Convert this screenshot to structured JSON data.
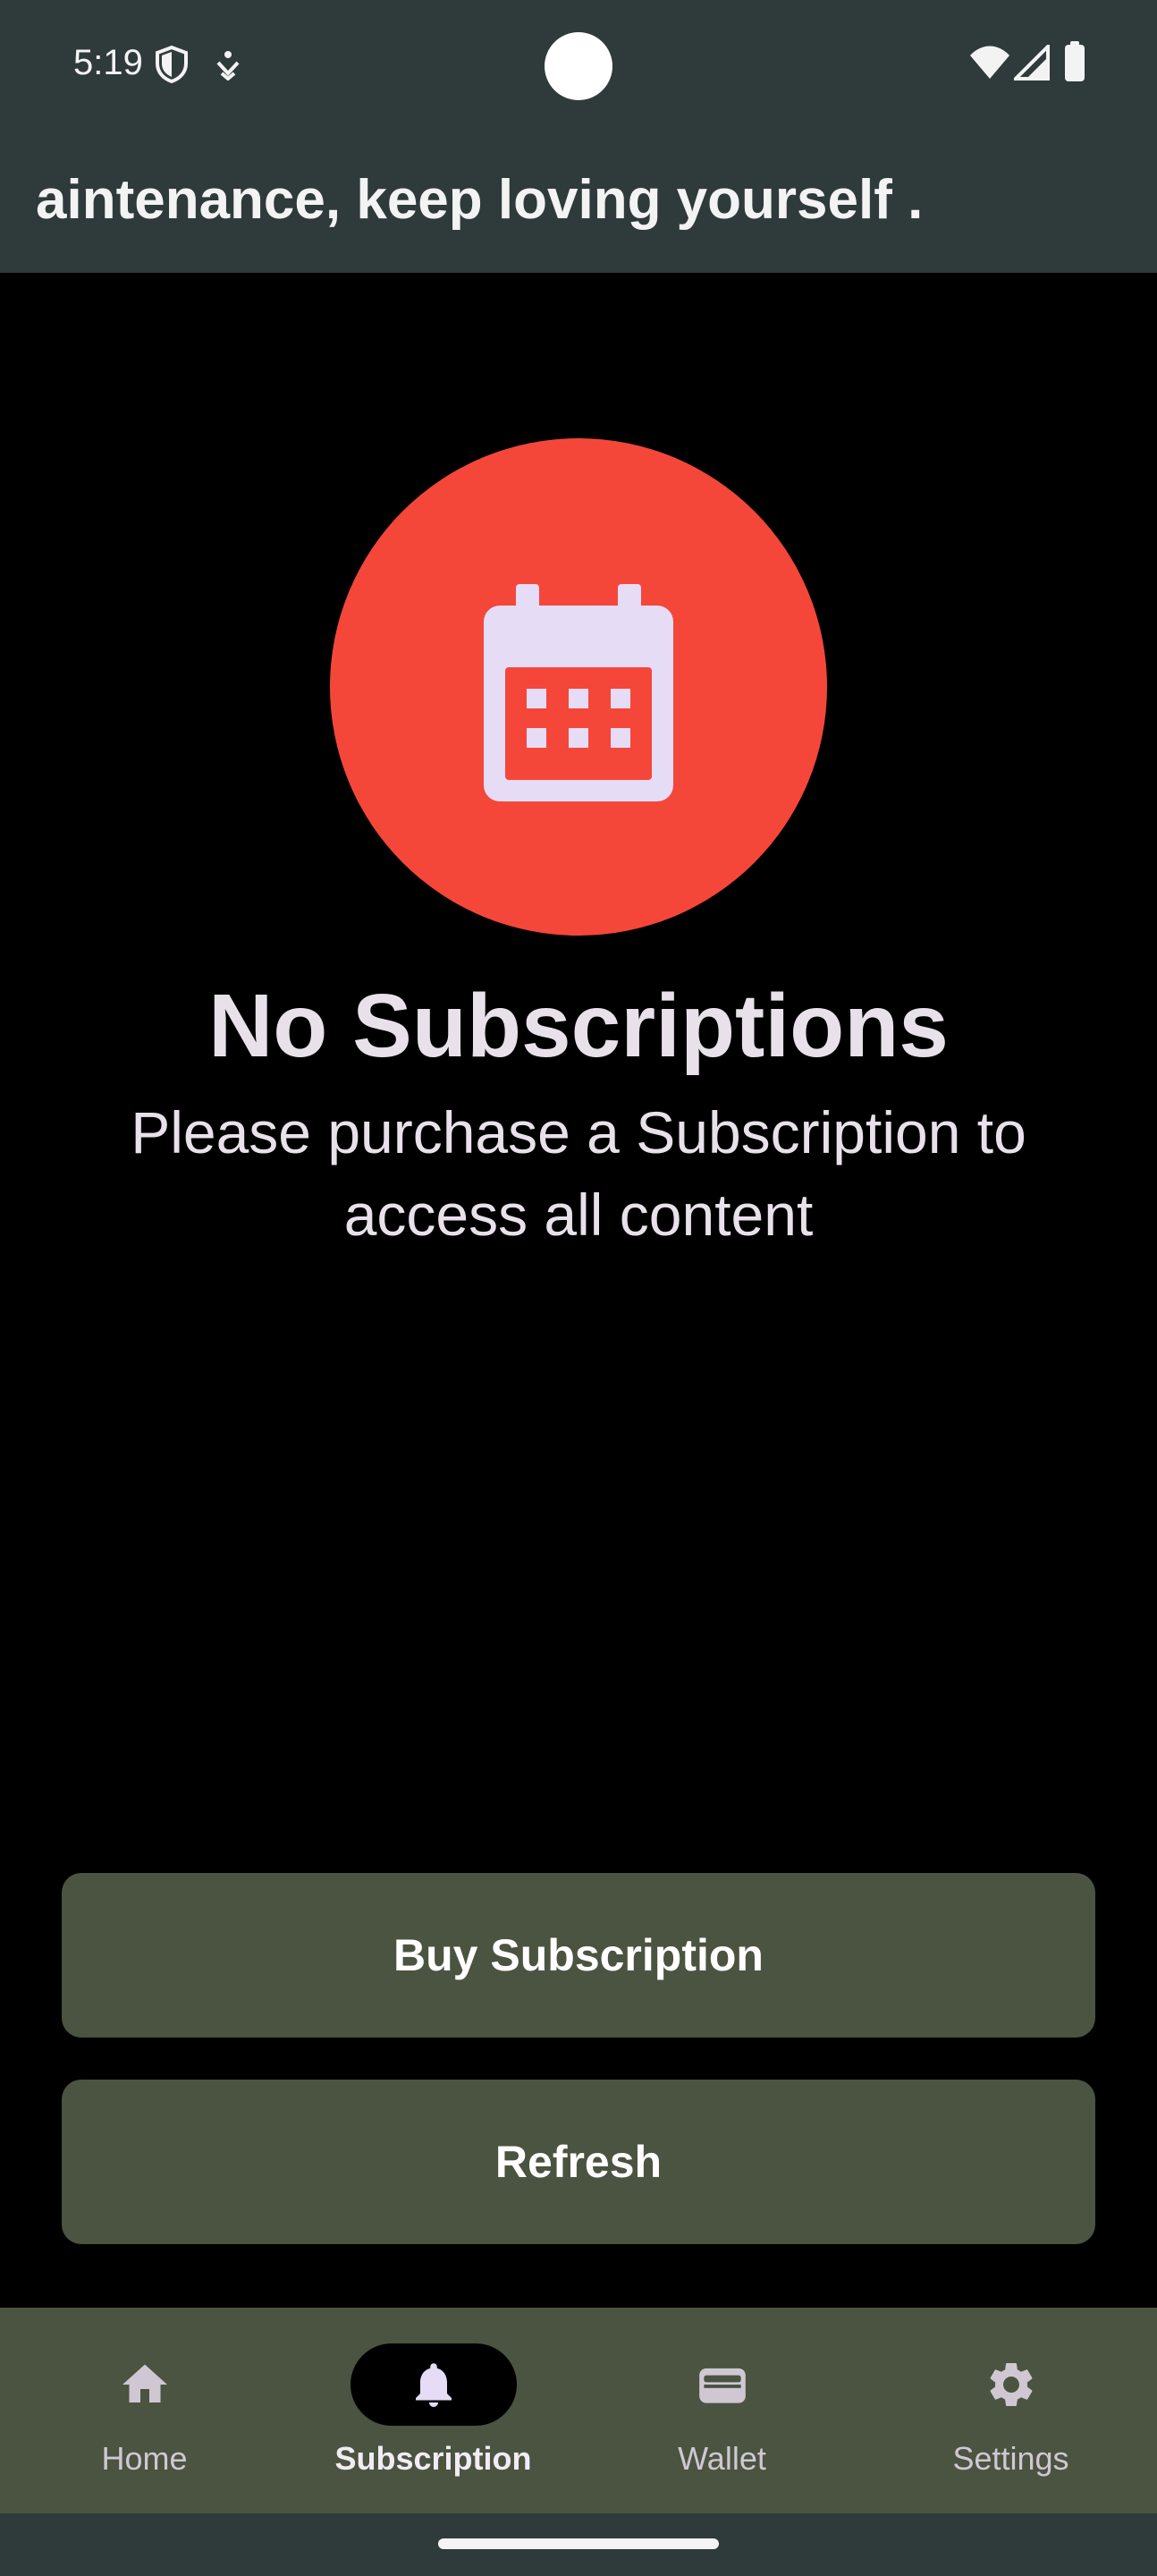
{
  "status_bar": {
    "time": "5:19"
  },
  "header": {
    "marquee_text": "aintenance, keep loving yourself ."
  },
  "empty_state": {
    "title": "No Subscriptions",
    "subtitle_line1": "Please purchase a Subscription to",
    "subtitle_line2": "access all content",
    "icon": "calendar-icon",
    "icon_bg_color": "#f4473a"
  },
  "actions": {
    "buy_label": "Buy Subscription",
    "refresh_label": "Refresh",
    "button_color": "#4a5440"
  },
  "bottom_nav": {
    "active_index": 1,
    "items": [
      {
        "label": "Home",
        "icon": "home-icon"
      },
      {
        "label": "Subscription",
        "icon": "bell-icon"
      },
      {
        "label": "Wallet",
        "icon": "wallet-icon"
      },
      {
        "label": "Settings",
        "icon": "gear-icon"
      }
    ]
  },
  "colors": {
    "status_bar": "#2f3a3a",
    "background": "#000000",
    "text": "#e8e1ea"
  }
}
